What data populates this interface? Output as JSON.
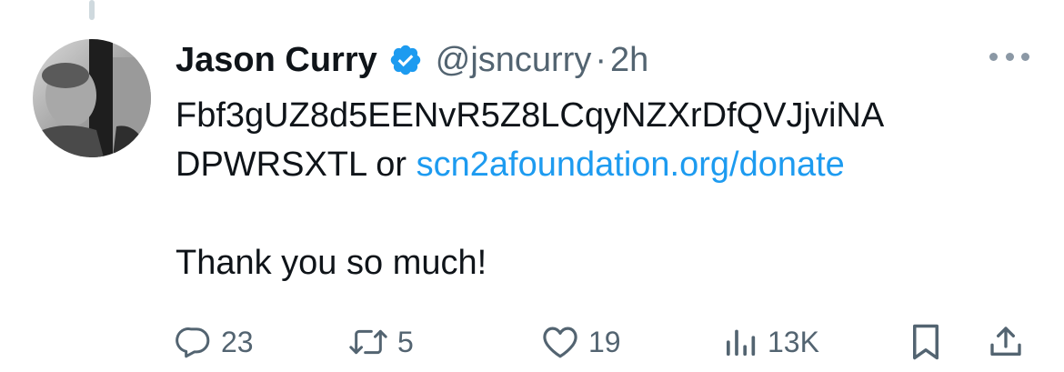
{
  "author": {
    "name": "Jason Curry",
    "handle": "@jsncurry",
    "separator": "·",
    "time": "2h"
  },
  "tweet": {
    "line1": "Fbf3gUZ8d5EENvR5Z8LCqyNZXrDfQVJjviNA",
    "line2_prefix": "DPWRSXTL or ",
    "link": "scn2afoundation.org/donate",
    "line3": "Thank you so much!"
  },
  "actions": {
    "replies": "23",
    "reposts": "5",
    "likes": "19",
    "views": "13K"
  },
  "icons": {
    "verified": "verified-badge-icon",
    "more": "more-icon",
    "reply": "reply-icon",
    "retweet": "retweet-icon",
    "like": "heart-icon",
    "views": "views-icon",
    "bookmark": "bookmark-icon",
    "share": "share-icon"
  },
  "colors": {
    "text": "#0f1419",
    "secondary": "#536471",
    "link": "#1d9bf0",
    "verified": "#1d9bf0"
  }
}
